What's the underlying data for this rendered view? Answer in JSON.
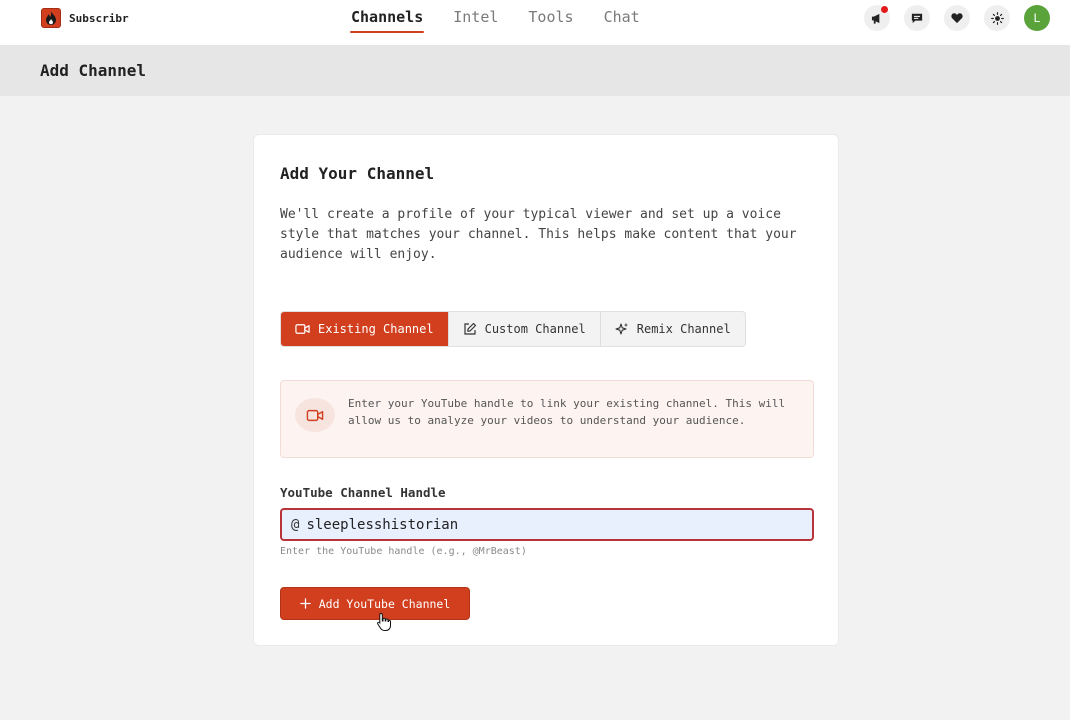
{
  "brand": {
    "name": "Subscribr",
    "logo_icon": "flame-icon",
    "accent": "#d23f1f"
  },
  "nav": {
    "tabs": [
      {
        "label": "Channels",
        "active": true
      },
      {
        "label": "Intel",
        "active": false
      },
      {
        "label": "Tools",
        "active": false
      },
      {
        "label": "Chat",
        "active": false
      }
    ]
  },
  "topbar_icons": [
    {
      "icon": "megaphone-icon",
      "has_badge": true
    },
    {
      "icon": "chat-icon"
    },
    {
      "icon": "heart-icon"
    },
    {
      "icon": "sun-icon"
    }
  ],
  "user": {
    "avatar_initial": "L",
    "avatar_color": "#5aa33a"
  },
  "page": {
    "title": "Add Channel"
  },
  "card": {
    "title": "Add Your Channel",
    "description": "We'll create a profile of your typical viewer and set up a voice style that matches your channel. This helps make content that your audience will enjoy.",
    "segments": [
      {
        "label": "Existing Channel",
        "icon": "video-icon",
        "active": true
      },
      {
        "label": "Custom Channel",
        "icon": "edit-icon",
        "active": false
      },
      {
        "label": "Remix Channel",
        "icon": "sparkle-icon",
        "active": false
      }
    ],
    "info": {
      "icon": "video-icon",
      "text": "Enter your YouTube handle to link your existing channel. This will allow us to analyze your videos to understand your audience."
    },
    "field": {
      "label": "YouTube Channel Handle",
      "prefix": "@",
      "value": "sleeplesshistorian",
      "hint": "Enter the YouTube handle (e.g., @MrBeast)"
    },
    "submit_label": "Add YouTube Channel"
  }
}
